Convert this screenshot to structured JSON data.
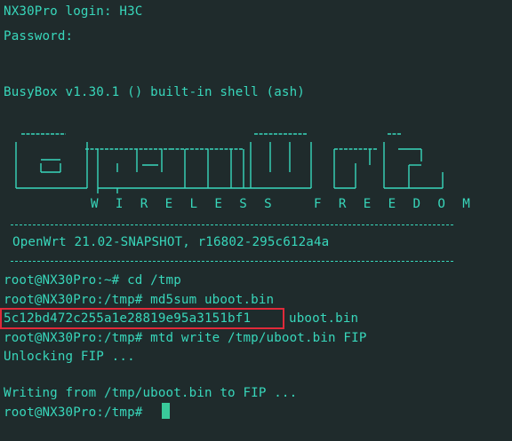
{
  "terminal": {
    "colors": {
      "background": "#1f2b2c",
      "text": "#38d7bb",
      "highlight_box": "#e02a3a",
      "cursor": "#39c99a"
    },
    "lines": {
      "login": "NX30Pro login: H3C",
      "password": "Password:",
      "busybox": "BusyBox v1.30.1 () built-in shell (ash)",
      "tagline": "W I R E L E S S   F R E E D O M",
      "version": "OpenWrt 21.02-SNAPSHOT, r16802-295c612a4a",
      "cmd_cd": "root@NX30Pro:~# cd /tmp",
      "cmd_md5": "root@NX30Pro:/tmp# md5sum uboot.bin",
      "md5_hash": "5c12bd472c255a1e28819e95a3151bf1",
      "md5_file": "uboot.bin",
      "cmd_mtd": "root@NX30Pro:/tmp# mtd write /tmp/uboot.bin FIP",
      "unlocking": "Unlocking FIP ...",
      "writing": "Writing from /tmp/uboot.bin to FIP ...",
      "prompt": "root@NX30Pro:/tmp#"
    },
    "banner_logo_text": "OpenWrt"
  }
}
